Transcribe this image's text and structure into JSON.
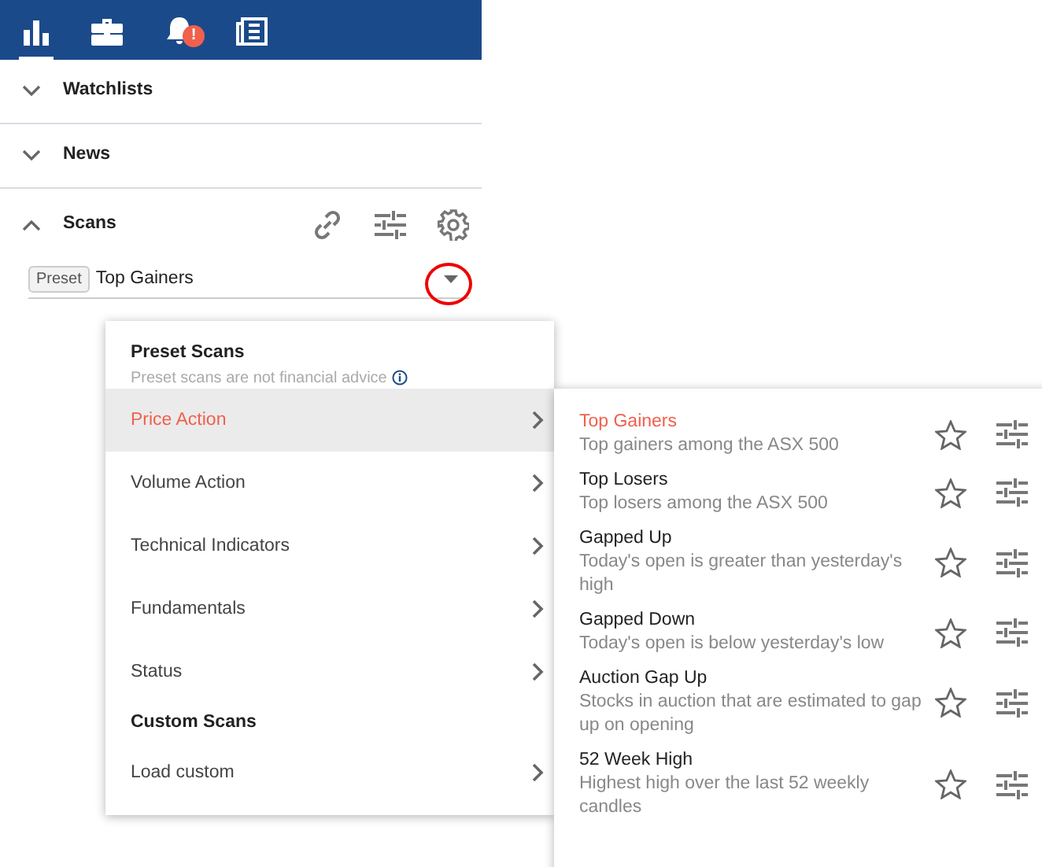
{
  "top_tabs": [
    {
      "kind": "chart",
      "selected": true
    },
    {
      "kind": "briefcase",
      "selected": false
    },
    {
      "kind": "bell",
      "selected": false,
      "badge": "!"
    },
    {
      "kind": "news",
      "selected": false
    }
  ],
  "sections": [
    {
      "title": "Watchlists",
      "expanded": false
    },
    {
      "title": "News",
      "expanded": false
    },
    {
      "title": "Scans",
      "expanded": true
    }
  ],
  "scan_select": {
    "tag": "Preset",
    "value": "Top Gainers"
  },
  "menu": {
    "heading": "Preset Scans",
    "note": "Preset scans are not financial advice",
    "items": [
      {
        "kind": "item",
        "label": "Price Action",
        "selected": true
      },
      {
        "kind": "item",
        "label": "Volume Action",
        "selected": false
      },
      {
        "kind": "item",
        "label": "Technical Indicators",
        "selected": false
      },
      {
        "kind": "item",
        "label": "Fundamentals",
        "selected": false
      },
      {
        "kind": "item",
        "label": "Status",
        "selected": false
      },
      {
        "kind": "heading",
        "label": "Custom Scans"
      },
      {
        "kind": "item",
        "label": "Load custom",
        "selected": false
      }
    ]
  },
  "submenu": [
    {
      "title": "Top Gainers",
      "description": "Top gainers among the ASX 500",
      "selected": true
    },
    {
      "title": "Top Losers",
      "description": "Top losers among the ASX 500",
      "selected": false
    },
    {
      "title": "Gapped Up",
      "description": "Today's open is greater than yesterday's high",
      "selected": false
    },
    {
      "title": "Gapped Down",
      "description": "Today's open is below yesterday's low",
      "selected": false
    },
    {
      "title": "Auction Gap Up",
      "description": "Stocks in auction that are estimated to gap up on opening",
      "selected": false
    },
    {
      "title": "52 Week High",
      "description": "Highest high over the last 52 weekly candles",
      "selected": false
    }
  ]
}
